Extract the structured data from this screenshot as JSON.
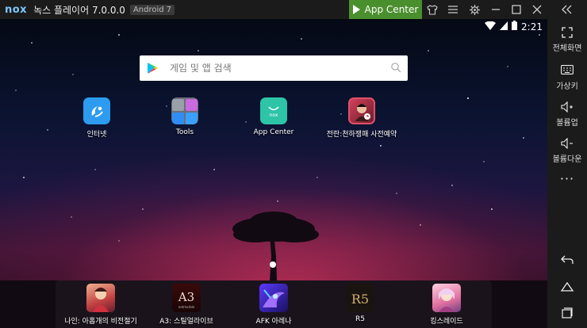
{
  "titlebar": {
    "logo": "nox",
    "title": "녹스 플레이어 7.0.0.0",
    "android_badge": "Android 7",
    "app_center_label": "App Center",
    "icons": [
      "shirt-icon",
      "menu-icon",
      "gear-icon",
      "minimize-icon",
      "maximize-icon",
      "close-icon",
      "collapse-icon"
    ]
  },
  "sidebar": {
    "items": [
      {
        "icon": "fullscreen-icon",
        "label": "전체화면"
      },
      {
        "icon": "keyboard-icon",
        "label": "가상키"
      },
      {
        "icon": "volume-up-icon",
        "label": "볼륨업"
      },
      {
        "icon": "volume-down-icon",
        "label": "볼륨다운"
      },
      {
        "icon": "more-icon",
        "label": "···"
      }
    ],
    "nav": [
      "back-icon",
      "home-icon",
      "recents-icon"
    ]
  },
  "status": {
    "time": "2:21"
  },
  "search": {
    "placeholder": "게임 및 앱 검색"
  },
  "apps": [
    {
      "label": "인터넷",
      "color": "#2d9cf0"
    },
    {
      "label": "Tools",
      "color": "#6a6f7a"
    },
    {
      "label": "App Center",
      "color": "#2ec4a8"
    },
    {
      "label": "전란:천하쟁패 사전예약",
      "color": "#c8304a"
    }
  ],
  "dock": [
    {
      "label": "나인: 아홉개의 비전절기"
    },
    {
      "label": "A3: 스틸얼라이브"
    },
    {
      "label": "AFK 아레나"
    },
    {
      "label": "R5"
    },
    {
      "label": "킹스레이드"
    }
  ]
}
